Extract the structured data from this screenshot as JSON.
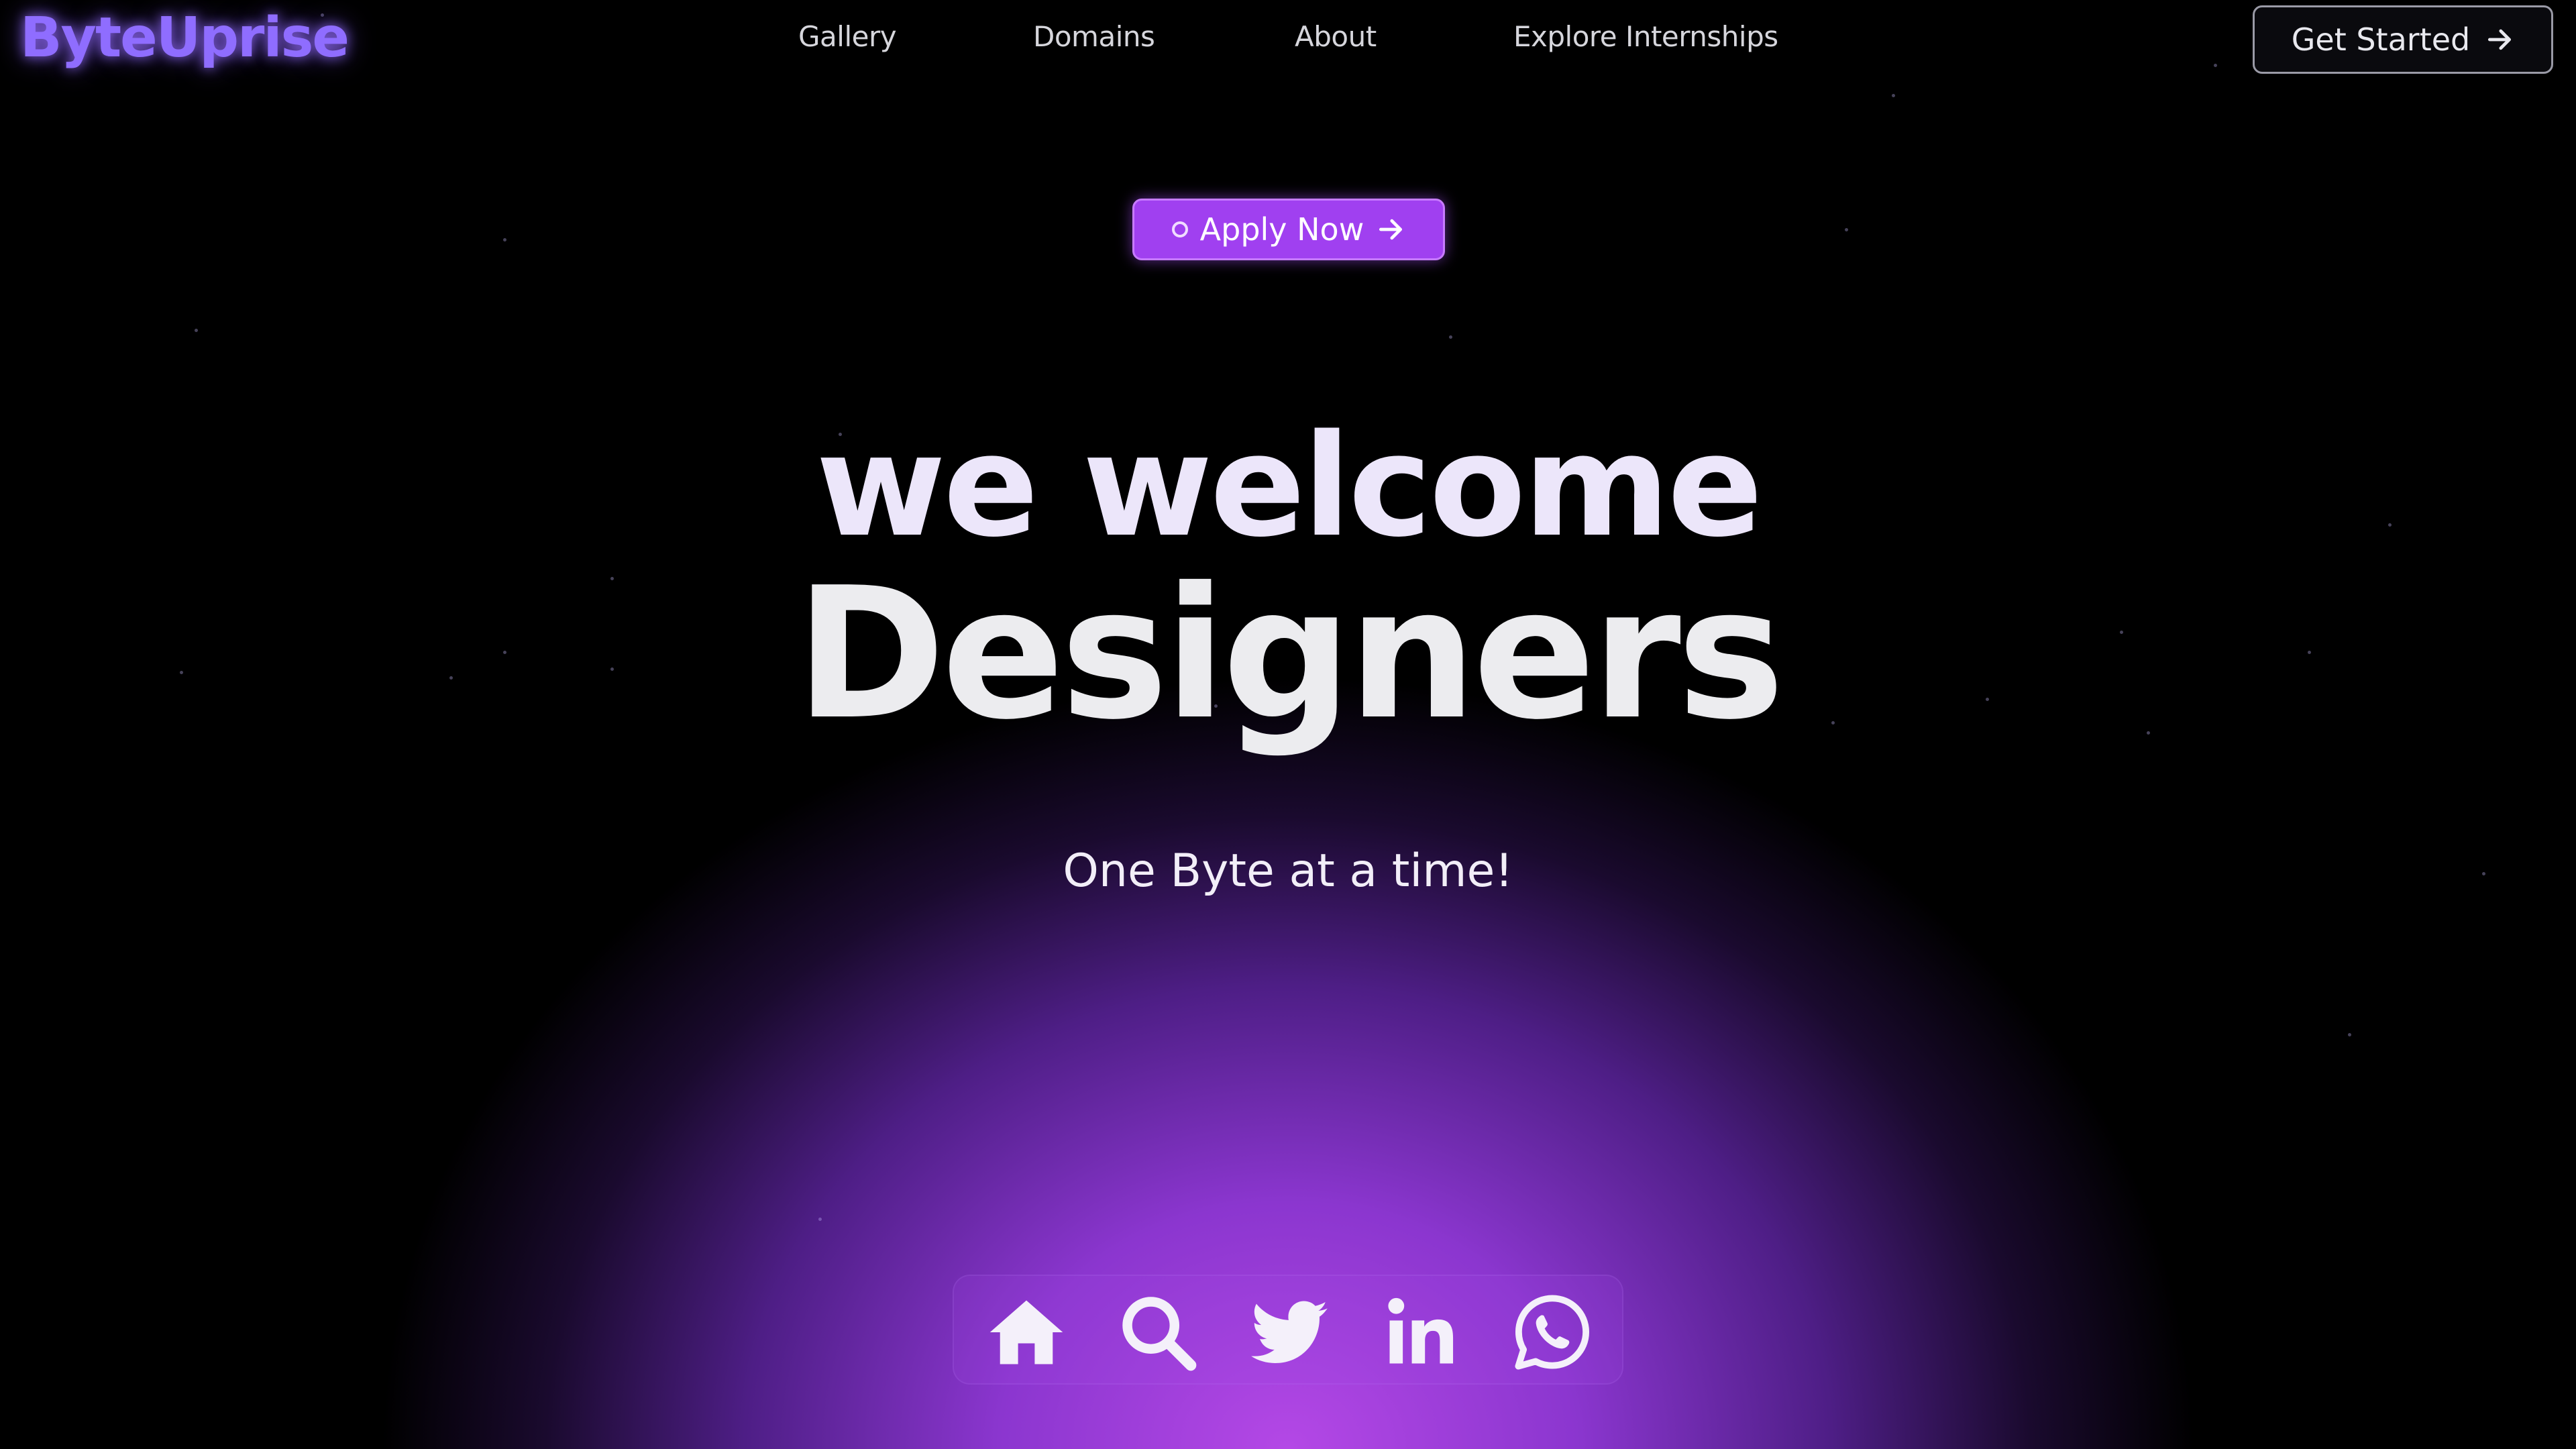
{
  "brand": {
    "name": "ByteUprise",
    "color": "#8f6dff"
  },
  "nav": {
    "links": [
      {
        "label": "Gallery"
      },
      {
        "label": "Domains"
      },
      {
        "label": "About"
      },
      {
        "label": "Explore Internships"
      }
    ],
    "cta": {
      "label": "Get Started",
      "icon": "arrow-right-icon"
    }
  },
  "hero": {
    "apply": {
      "label": "Apply Now",
      "icon": "arrow-right-icon",
      "accent": "#a040f0"
    },
    "headline_line1": "we welcome",
    "headline_line2": "Designers",
    "tagline": "One Byte at a time!"
  },
  "dock": {
    "icons": [
      "home-icon",
      "search-icon",
      "twitter-icon",
      "linkedin-icon",
      "whatsapp-icon"
    ]
  },
  "colors": {
    "background": "#000000",
    "glow": "#b448e6",
    "text": "#ece6fa"
  }
}
